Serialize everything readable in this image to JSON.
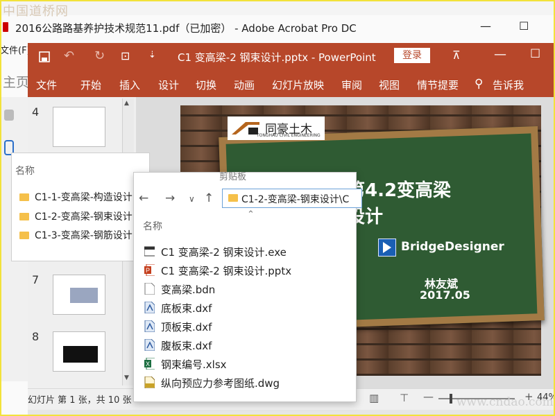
{
  "watermark_top": "中国道桥网",
  "watermark_bottom": "www.cndao.com",
  "acrobat": {
    "title": "2016公路路基养护技术规范11.pdf（已加密） - Adobe Acrobat Pro DC",
    "menu_file": "文件(F)",
    "home": "主页",
    "minimize": "—",
    "maximize": "☐"
  },
  "ppt": {
    "title": "C1 变高梁-2 钢束设计.pptx  -  PowerPoint",
    "login": "登录",
    "ribbon_tabs": [
      "文件",
      "开始",
      "插入",
      "设计",
      "切换",
      "动画",
      "幻灯片放映",
      "审阅",
      "视图",
      "情节提要"
    ],
    "tell_me": "告诉我",
    "thumb_numbers": [
      "4",
      "7",
      "8"
    ],
    "status": "幻灯片 第 1 张，共 10 张",
    "zoom": "44%",
    "slide": {
      "logo": "同豪土木",
      "logo_sub": "TONGHAO CIVIL ENGINEERING",
      "title_line1": "第4.2变高梁",
      "title_line2": "设计",
      "tool": "BridgeDesigner",
      "author": "林友斌",
      "date": "2017.05"
    }
  },
  "explorer_back": {
    "header": "名称",
    "items": [
      "C1-1-变高梁-构造设计",
      "C1-2-变高梁-钢束设计",
      "C1-3-变高梁-钢筋设计"
    ]
  },
  "explorer_front": {
    "clipboard_label": "剪贴板",
    "path": "C1-2-变高梁-钢束设计\\C",
    "header": "名称",
    "files": [
      {
        "name": "C1 变高梁-2 钢束设计.exe",
        "icon": "exe-icon"
      },
      {
        "name": "C1 变高梁-2 钢束设计.pptx",
        "icon": "pptx-icon"
      },
      {
        "name": "变高梁.bdn",
        "icon": "file-icon"
      },
      {
        "name": "底板束.dxf",
        "icon": "dxf-icon"
      },
      {
        "name": "顶板束.dxf",
        "icon": "dxf-icon"
      },
      {
        "name": "腹板束.dxf",
        "icon": "dxf-icon"
      },
      {
        "name": "钢束编号.xlsx",
        "icon": "xlsx-icon"
      },
      {
        "name": "纵向预应力参考图纸.dwg",
        "icon": "dwg-icon"
      }
    ]
  },
  "colors": {
    "ppt_accent": "#b7472a",
    "board": "#2f5b33",
    "frame": "#f2e23a"
  }
}
